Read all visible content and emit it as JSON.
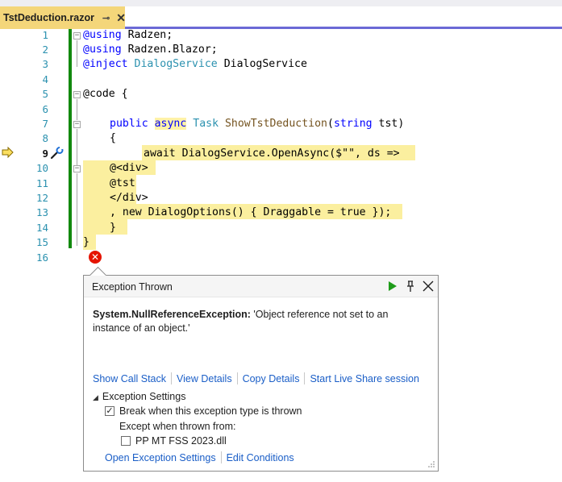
{
  "tab": {
    "filename": "TstDeduction.razor",
    "pin_glyph": "⊸",
    "close_glyph": "✕"
  },
  "editor": {
    "line_numbers": [
      "1",
      "2",
      "3",
      "4",
      "5",
      "6",
      "7",
      "8",
      "9",
      "10",
      "11",
      "12",
      "13",
      "14",
      "15",
      "16"
    ],
    "current_line": "9"
  },
  "code": {
    "l1_kw": "@using",
    "l1_rest": " Radzen;",
    "l2_kw": "@using",
    "l2_rest": " Radzen.Blazor;",
    "l3_kw": "@inject",
    "l3_sp": " ",
    "l3_type": "DialogService",
    "l3_name": " DialogService",
    "l5": "@code {",
    "l7_public": "public",
    "l7_async": "async",
    "l7_task": "Task",
    "l7_method": "ShowTstDeduction",
    "l7_open": "(",
    "l7_string": "string",
    "l7_rest": " tst)",
    "l8": "{",
    "l9": "await DialogService.OpenAsync($\"\", ds =>",
    "l10": "@<div>",
    "l11": "@tst",
    "l12": "</div>",
    "l13": ", new DialogOptions() { Draggable = true });",
    "l14": "}",
    "l15": "}"
  },
  "exception": {
    "title": "Exception Thrown",
    "type": "System.NullReferenceException:",
    "message": " 'Object reference not set to an instance of an object.'",
    "links": [
      "Show Call Stack",
      "View Details",
      "Copy Details",
      "Start Live Share session"
    ],
    "settings_label": "Exception Settings",
    "break_label": "Break when this exception type is thrown",
    "break_checked": "✓",
    "except_label": "Except when thrown from:",
    "dll_label": "PP MT FSS 2023.dll",
    "bottom_links": [
      "Open Exception Settings",
      "Edit Conditions"
    ]
  },
  "colors": {
    "accent": "#6b69d6",
    "tab_active": "#f4d67a",
    "change_bar": "#12890e",
    "highlight": "#fbef9f",
    "error": "#e51400",
    "link": "#1a5ec7"
  },
  "icons": [
    "current-statement-arrow-icon",
    "quick-actions-icon",
    "error-icon",
    "continue-icon",
    "pin-icon",
    "close-icon",
    "resize-grip-icon"
  ]
}
